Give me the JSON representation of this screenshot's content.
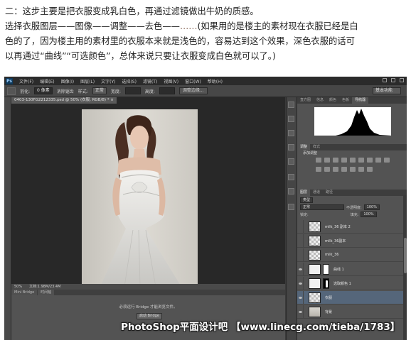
{
  "instructions": {
    "line1": "二：这步主要是把衣服变成乳白色，再通过滤镜做出牛奶的质感。",
    "line2_a": "选择衣服图层——图像——调整——去色——",
    "line2_ellipsis": "……",
    "line2_b": "(如果用的是楼主的素材现在衣服已经是白",
    "line3": "色的了，因为楼主用的素材里的衣服本来就是浅色的，容易达到这个效果，深色衣服的话可",
    "line4": "以再通过“曲线”“可选颜色”，总体来说只要让衣服变成白色就可以了。)"
  },
  "photoshop": {
    "logo": "Ps",
    "menu": [
      "文件(F)",
      "编辑(E)",
      "图像(I)",
      "图层(L)",
      "文字(Y)",
      "选择(S)",
      "滤镜(T)",
      "视图(V)",
      "窗口(W)",
      "帮助(H)"
    ],
    "options": {
      "feather_label": "羽化:",
      "feather_value": "0 像素",
      "antialias": "消除锯齿",
      "style_label": "样式:",
      "style_value": "正常",
      "width_label": "宽度:",
      "height_label": "高度:",
      "refine_edge": "调整边缘..."
    },
    "workspace": "基本功能",
    "document_tab": "0403-130FG2212335.psd @ 50% (衣服, RGB/8) * ×",
    "status": {
      "zoom": "50%",
      "doc": "文档:1.98M/23.4M"
    },
    "bridge": {
      "tabs": [
        "Mini Bridge",
        "时间轴"
      ],
      "message": "必须运行 Bridge 才能浏览文件。",
      "launch_button": "启动 Bridge"
    },
    "panels": {
      "histogram_tabs": [
        "直方图",
        "信息",
        "颜色",
        "色板",
        "导航器"
      ],
      "adjust_tabs": [
        "调整",
        "样式"
      ],
      "adjust_label": "添加调整",
      "layers_tabs": [
        "图层",
        "通道",
        "路径"
      ],
      "kind_filter": "类型",
      "blend_mode": "正常",
      "opacity_label": "不透明度:",
      "opacity_value": "100%",
      "lock_label": "锁定:",
      "fill_label": "填充:",
      "fill_value": "100%",
      "layers": [
        {
          "name": "milk_36 副本 2",
          "thumb": "checker",
          "mask": "",
          "selected": false
        },
        {
          "name": "milk_36副本",
          "thumb": "checker",
          "mask": "",
          "selected": false
        },
        {
          "name": "milk_36",
          "thumb": "checker",
          "mask": "",
          "selected": false
        },
        {
          "name": "曲线 1",
          "thumb": "adjw",
          "mask": "white",
          "selected": false
        },
        {
          "name": "选取颜色 1",
          "thumb": "adjw",
          "mask": "black",
          "selected": false
        },
        {
          "name": "衣服",
          "thumb": "checker",
          "mask": "",
          "selected": true
        },
        {
          "name": "背景",
          "thumb": "photo",
          "mask": "",
          "selected": false
        }
      ]
    }
  },
  "watermark": "PhotoShop平面设计吧 【www.linecg.com/tieba/1783】"
}
